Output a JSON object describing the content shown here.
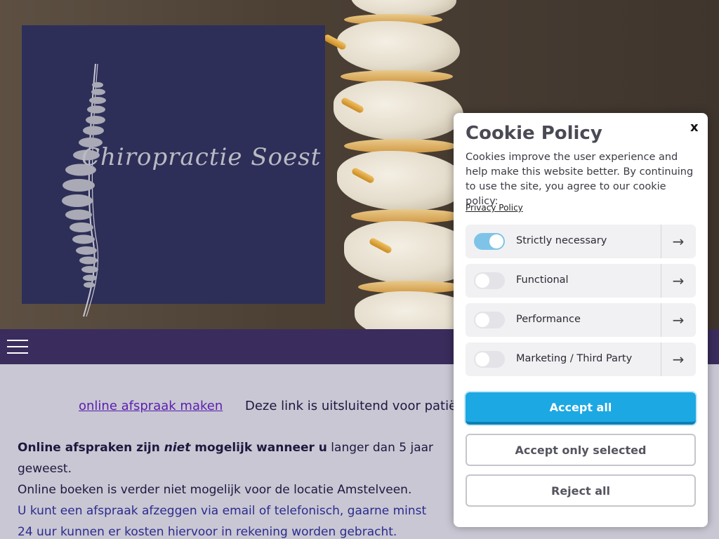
{
  "hero": {
    "logo_text": "Chiropractie Soest"
  },
  "nav": {
    "menu_icon": "hamburger-menu-icon"
  },
  "content": {
    "appointment_link": "online afspraak maken",
    "link_note": "Deze link is uitsluitend voor patië",
    "line1_bold_a": "Online afspraken zijn ",
    "line1_italic": "niet",
    "line1_bold_b": " mogelijk wanneer u",
    "line1_rest": " langer dan 5 jaar",
    "line2": "geweest.",
    "line3": "Online boeken is verder niet mogelijk voor de locatie Amstelveen.",
    "line4": "U kunt een afspraak afzeggen via email of telefonisch, gaarne minst",
    "line5": "24 uur kunnen er kosten hiervoor in rekening worden gebracht."
  },
  "cookie": {
    "title": "Cookie Policy",
    "close": "x",
    "description": "Cookies improve the user experience and help make this website better. By continuing to use the site, you agree to our cookie policy:",
    "privacy_link": "Privacy Policy",
    "categories": [
      {
        "label": "Strictly necessary",
        "enabled": true
      },
      {
        "label": "Functional",
        "enabled": false
      },
      {
        "label": "Performance",
        "enabled": false
      },
      {
        "label": "Marketing / Third Party",
        "enabled": false
      }
    ],
    "arrow_icon": "arrow-right-icon",
    "accept_all": "Accept all",
    "accept_selected": "Accept only selected",
    "reject_all": "Reject all"
  },
  "colors": {
    "nav_bg": "#3a2c5c",
    "logo_bg": "#2e2f58",
    "accept_all_bg": "#1ca8e3",
    "toggle_on": "#7fc4e8",
    "link": "#5a1eb0"
  }
}
